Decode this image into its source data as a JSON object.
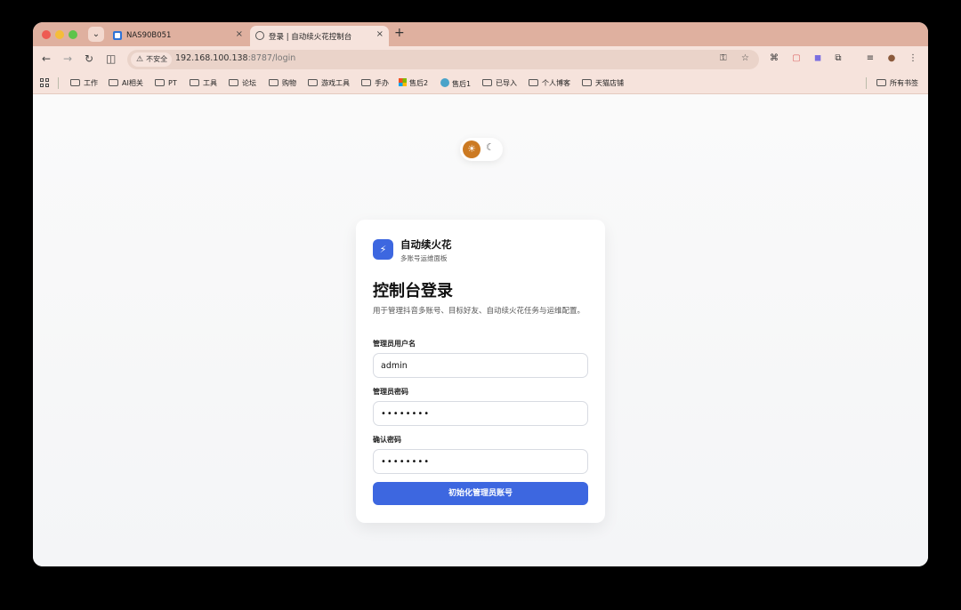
{
  "browser": {
    "tabs": [
      {
        "title": "NAS90B051",
        "close": "×"
      },
      {
        "title": "登录 | 自动续火花控制台",
        "close": "×"
      }
    ],
    "tab_dropdown": "⌄",
    "new_tab": "+",
    "nav": {
      "back": "←",
      "forward": "→",
      "reload": "↻",
      "split": "◫"
    },
    "address": {
      "security_label": "不安全",
      "warning_icon": "⚠",
      "host": "192.168.100.138",
      "path": ":8787/login",
      "key_icon": "⚿",
      "star_icon": "☆"
    },
    "extensions": [
      "⌘",
      "▢",
      "◼",
      "⧉",
      "≡",
      "●",
      "⋮"
    ],
    "bookmarks": [
      {
        "label": "工作",
        "icon": "folder"
      },
      {
        "label": "AI相关",
        "icon": "folder"
      },
      {
        "label": "PT",
        "icon": "folder"
      },
      {
        "label": "工具",
        "icon": "folder"
      },
      {
        "label": "论坛",
        "icon": "folder"
      },
      {
        "label": "购物",
        "icon": "folder"
      },
      {
        "label": "游戏工具",
        "icon": "folder"
      },
      {
        "label": "手办",
        "icon": "folder"
      },
      {
        "label": "售后2",
        "icon": "microsoft"
      },
      {
        "label": "售后1",
        "icon": "globe"
      },
      {
        "label": "已导入",
        "icon": "folder"
      },
      {
        "label": "个人博客",
        "icon": "folder"
      },
      {
        "label": "天猫店铺",
        "icon": "folder"
      }
    ],
    "all_bookmarks": "所有书签"
  },
  "theme_toggle": {
    "light_icon": "☀",
    "dark_icon": "☾",
    "active": "light"
  },
  "card": {
    "logo_icon": "⚡",
    "brand_name": "自动续火花",
    "brand_sub": "多账号运维面板",
    "heading": "控制台登录",
    "description": "用于管理抖音多账号、目标好友、自动续火花任务与运维配置。",
    "fields": [
      {
        "label": "管理员用户名",
        "value": "admin",
        "type": "text"
      },
      {
        "label": "管理员密码",
        "value": "••••••••",
        "type": "password"
      },
      {
        "label": "确认密码",
        "value": "••••••••",
        "type": "password"
      }
    ],
    "submit_label": "初始化管理员账号"
  },
  "colors": {
    "accent": "#3d67e0",
    "tab_bar": "#dfb09f",
    "toolbar": "#f6e3dc",
    "sun": "#cc7a22"
  }
}
